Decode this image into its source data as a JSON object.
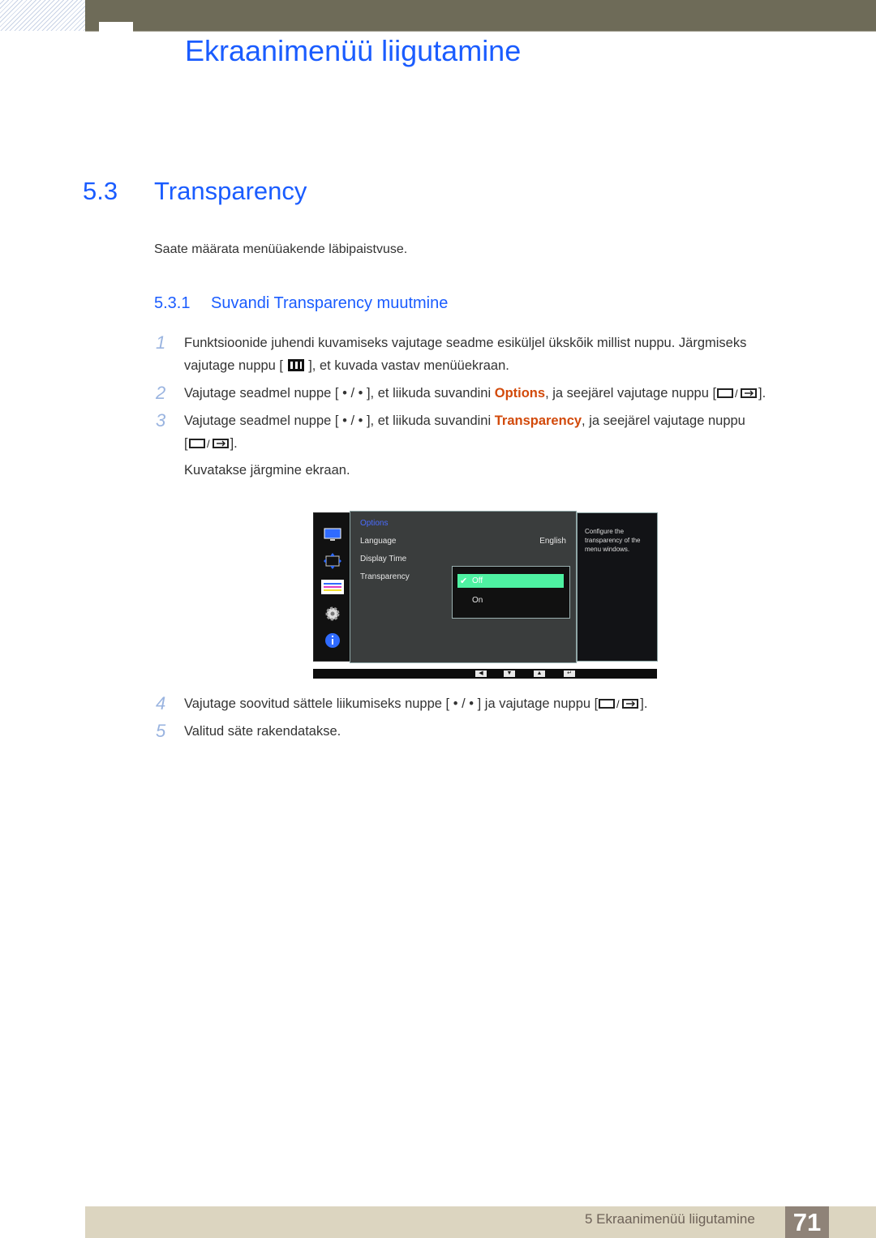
{
  "header": {
    "chapter_title": "Ekraanimenüü liigutamine"
  },
  "section": {
    "number": "5.3",
    "title": "Transparency",
    "intro": "Saate määrata menüüakende läbipaistvuse."
  },
  "subsection": {
    "number": "5.3.1",
    "title": "Suvandi Transparency muutmine"
  },
  "steps": [
    {
      "num": "1",
      "line1": "Funktsioonide juhendi kuvamiseks vajutage seadme esiküljel ükskõik millist nuppu. Järgmiseks",
      "line2_pre": "vajutage nuppu [",
      "line2_post": "], et kuvada vastav menüüekraan."
    },
    {
      "num": "2",
      "pre": "Vajutage seadmel nuppe [ • / • ], et liikuda suvandini ",
      "highlight": "Options",
      "post": ", ja seejärel vajutage nuppu [",
      "end": "]."
    },
    {
      "num": "3",
      "pre": "Vajutage seadmel nuppe [ • / • ], et liikuda suvandini ",
      "highlight": "Transparency",
      "post": ", ja seejärel vajutage nuppu",
      "line2_pre": "[",
      "line2_end": "].",
      "note": "Kuvatakse järgmine ekraan."
    },
    {
      "num": "4",
      "pre": "Vajutage soovitud sättele liikumiseks nuppe [ • / • ] ja vajutage nuppu [",
      "end": "]."
    },
    {
      "num": "5",
      "text": "Valitud säte rakendatakse."
    }
  ],
  "osd": {
    "menu_title": "Options",
    "items": [
      {
        "label": "Language",
        "value": "English"
      },
      {
        "label": "Display Time",
        "value": ""
      },
      {
        "label": "Transparency",
        "value": ""
      }
    ],
    "popup_options": [
      "Off",
      "On"
    ],
    "selected_option": "Off",
    "help_text_lines": [
      "Configure the",
      "transparency of the",
      "menu windows."
    ],
    "sidebar_icons": [
      "monitor-icon",
      "size-position-icon",
      "options-menu-icon",
      "gear-icon",
      "info-icon"
    ],
    "nav_buttons": [
      "◀",
      "▼",
      "▲",
      "↵"
    ]
  },
  "footer": {
    "chapter_label": "5 Ekraanimenüü liigutamine",
    "page_number": "71"
  },
  "colors": {
    "heading_blue": "#1a5cff",
    "highlight_orange": "#d24a0b",
    "selected_green": "#4ef2a2"
  }
}
